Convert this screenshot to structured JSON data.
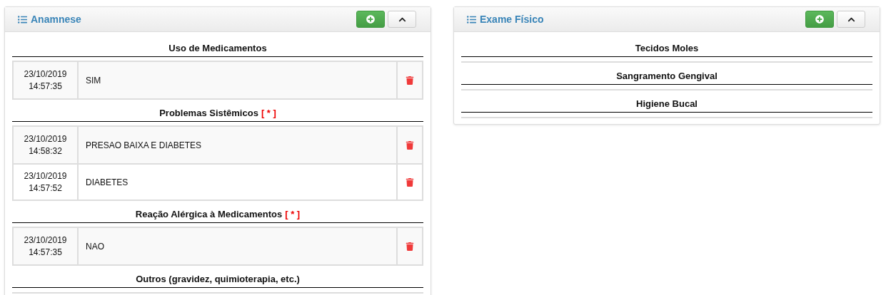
{
  "panels": [
    {
      "title": "Anamnese",
      "sections": [
        {
          "title": "Uso de Medicamentos",
          "entries": [
            {
              "date": "23/10/2019",
              "time": "14:57:35",
              "text": "SIM"
            }
          ]
        },
        {
          "title": "Problemas Sistêmicos",
          "marker": "[ * ]",
          "entries": [
            {
              "date": "23/10/2019",
              "time": "14:58:32",
              "text": "PRESAO BAIXA E DIABETES"
            },
            {
              "date": "23/10/2019",
              "time": "14:57:52",
              "text": "DIABETES"
            }
          ]
        },
        {
          "title": "Reação Alérgica à Medicamentos",
          "marker": "[ * ]",
          "entries": [
            {
              "date": "23/10/2019",
              "time": "14:57:35",
              "text": "NAO"
            }
          ]
        },
        {
          "title": "Outros (gravidez, quimioterapia, etc.)"
        }
      ]
    },
    {
      "title": "Exame Físico",
      "sections": [
        {
          "title": "Tecidos Moles"
        },
        {
          "title": "Sangramento Gengival"
        },
        {
          "title": "Higiene Bucal"
        }
      ]
    }
  ]
}
